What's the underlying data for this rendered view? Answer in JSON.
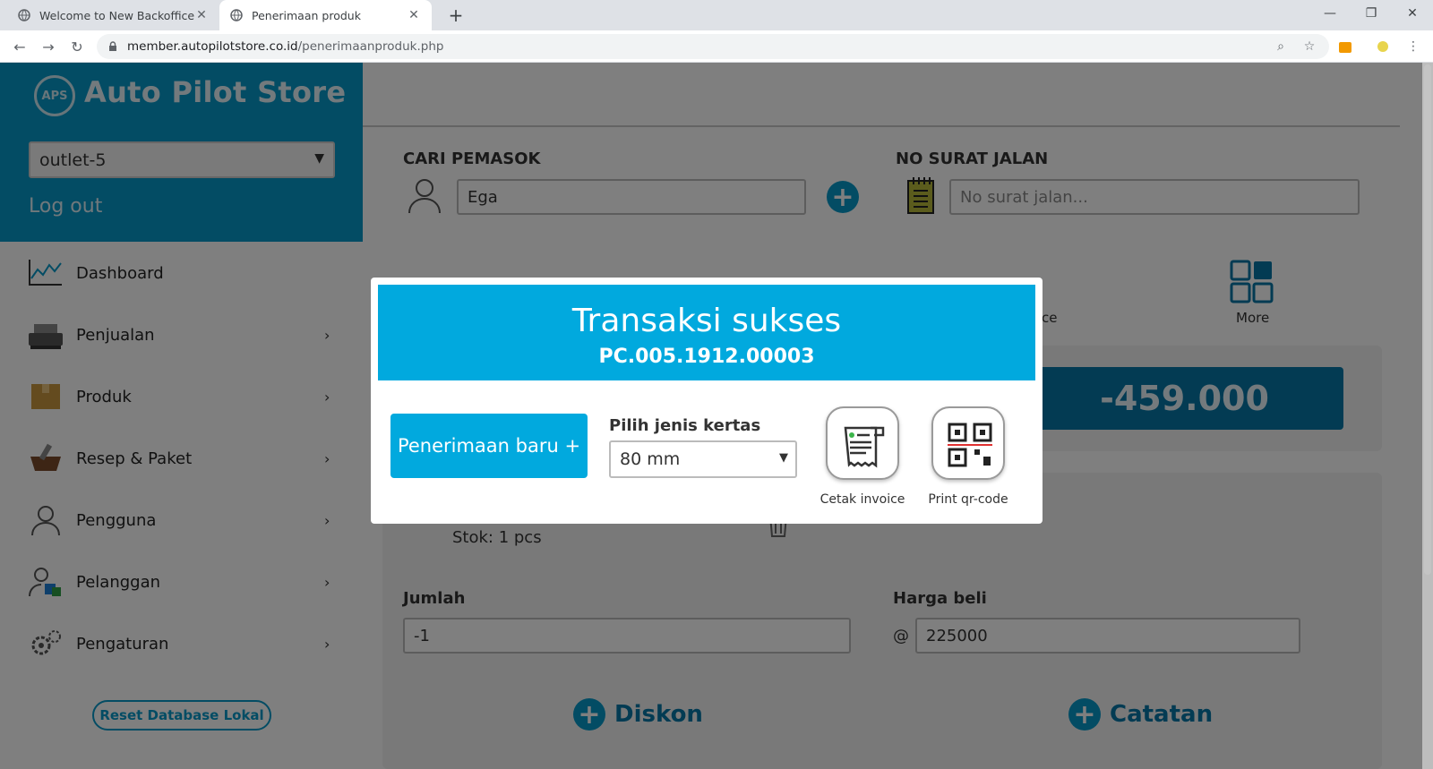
{
  "browser": {
    "tabs": [
      {
        "label": "Welcome to New Backoffice",
        "active": false
      },
      {
        "label": "Penerimaan produk",
        "active": true
      }
    ],
    "url_host": "member.autopilotstore.co.id",
    "url_path": "/penerimaanproduk.php"
  },
  "sidebar": {
    "brand_logo": "APS",
    "brand_title": "Auto Pilot Store",
    "outlet_selected": "outlet-5",
    "logout_label": "Log out",
    "menu": [
      {
        "label": "Dashboard",
        "icon": "chart-icon",
        "has_submenu": false
      },
      {
        "label": "Penjualan",
        "icon": "cash-register-icon",
        "has_submenu": true
      },
      {
        "label": "Produk",
        "icon": "box-icon",
        "has_submenu": true
      },
      {
        "label": "Resep & Paket",
        "icon": "mortar-icon",
        "has_submenu": true
      },
      {
        "label": "Pengguna",
        "icon": "user-icon",
        "has_submenu": true
      },
      {
        "label": "Pelanggan",
        "icon": "customer-icon",
        "has_submenu": true
      },
      {
        "label": "Pengaturan",
        "icon": "gear-icon",
        "has_submenu": true
      }
    ],
    "reset_label": "Reset Database Lokal"
  },
  "main": {
    "supplier_label": "CARI PEMASOK",
    "supplier_value": "Ega",
    "surat_label": "NO SURAT JALAN",
    "surat_placeholder": "No surat jalan...",
    "partial_label": "ce",
    "more_label": "More",
    "total": "-459.000",
    "stok": "Stok: 1 pcs",
    "jumlah_label": "Jumlah",
    "jumlah_value": "-1",
    "harga_label": "Harga beli",
    "harga_prefix": "@",
    "harga_value": "225000",
    "diskon_label": "Diskon",
    "catatan_label": "Catatan"
  },
  "modal": {
    "title": "Transaksi sukses",
    "transaction_id": "PC.005.1912.00003",
    "new_button": "Penerimaan baru +",
    "paper_label": "Pilih jenis kertas",
    "paper_selected": "80 mm",
    "invoice_label": "Cetak invoice",
    "qr_label": "Print qr-code"
  },
  "colors": {
    "brand": "#0698c8",
    "modal_accent": "#01a9de",
    "total_bg": "#0677a6"
  }
}
